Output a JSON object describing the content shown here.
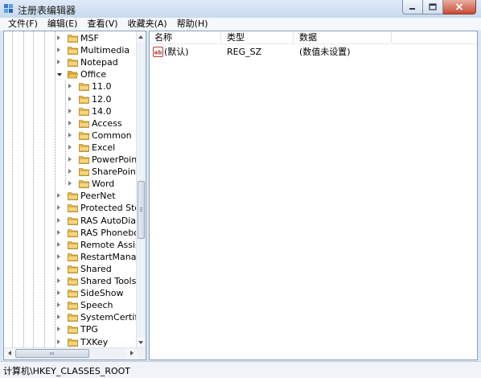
{
  "window": {
    "title": "注册表编辑器",
    "icon": "registry-editor-icon"
  },
  "menubar": {
    "items": [
      {
        "label": "文件(F)"
      },
      {
        "label": "编辑(E)"
      },
      {
        "label": "查看(V)"
      },
      {
        "label": "收藏夹(A)"
      },
      {
        "label": "帮助(H)"
      }
    ]
  },
  "tree": {
    "items": [
      {
        "label": "MSF",
        "level": 0,
        "expanded": false
      },
      {
        "label": "Multimedia",
        "level": 0,
        "expanded": false
      },
      {
        "label": "Notepad",
        "level": 0,
        "expanded": false
      },
      {
        "label": "Office",
        "level": 0,
        "expanded": true
      },
      {
        "label": "11.0",
        "level": 1,
        "expanded": false
      },
      {
        "label": "12.0",
        "level": 1,
        "expanded": false
      },
      {
        "label": "14.0",
        "level": 1,
        "expanded": false
      },
      {
        "label": "Access",
        "level": 1,
        "expanded": false
      },
      {
        "label": "Common",
        "level": 1,
        "expanded": false
      },
      {
        "label": "Excel",
        "level": 1,
        "expanded": false
      },
      {
        "label": "PowerPoint",
        "level": 1,
        "expanded": false
      },
      {
        "label": "SharePoint D",
        "level": 1,
        "expanded": false
      },
      {
        "label": "Word",
        "level": 1,
        "expanded": false
      },
      {
        "label": "PeerNet",
        "level": 0,
        "expanded": false
      },
      {
        "label": "Protected Storag",
        "level": 0,
        "expanded": false
      },
      {
        "label": "RAS AutoDial",
        "level": 0,
        "expanded": false
      },
      {
        "label": "RAS Phonebook",
        "level": 0,
        "expanded": false
      },
      {
        "label": "Remote Assistan",
        "level": 0,
        "expanded": false
      },
      {
        "label": "RestartManager",
        "level": 0,
        "expanded": false
      },
      {
        "label": "Shared",
        "level": 0,
        "expanded": false
      },
      {
        "label": "Shared Tools",
        "level": 0,
        "expanded": false
      },
      {
        "label": "SideShow",
        "level": 0,
        "expanded": false
      },
      {
        "label": "Speech",
        "level": 0,
        "expanded": false
      },
      {
        "label": "SystemCertificate",
        "level": 0,
        "expanded": false
      },
      {
        "label": "TPG",
        "level": 0,
        "expanded": false
      },
      {
        "label": "TXKey",
        "level": 0,
        "expanded": false
      }
    ]
  },
  "list": {
    "columns": {
      "name": "名称",
      "type": "类型",
      "data": "数据"
    },
    "rows": [
      {
        "name": "(默认)",
        "type": "REG_SZ",
        "data": "(数值未设置)",
        "icon": "string-value-icon"
      }
    ]
  },
  "statusbar": {
    "path": "计算机\\HKEY_CLASSES_ROOT"
  },
  "colors": {
    "window_frame": "#d9e6f4",
    "folder": "#f0c458",
    "close_button": "#c74a33"
  }
}
